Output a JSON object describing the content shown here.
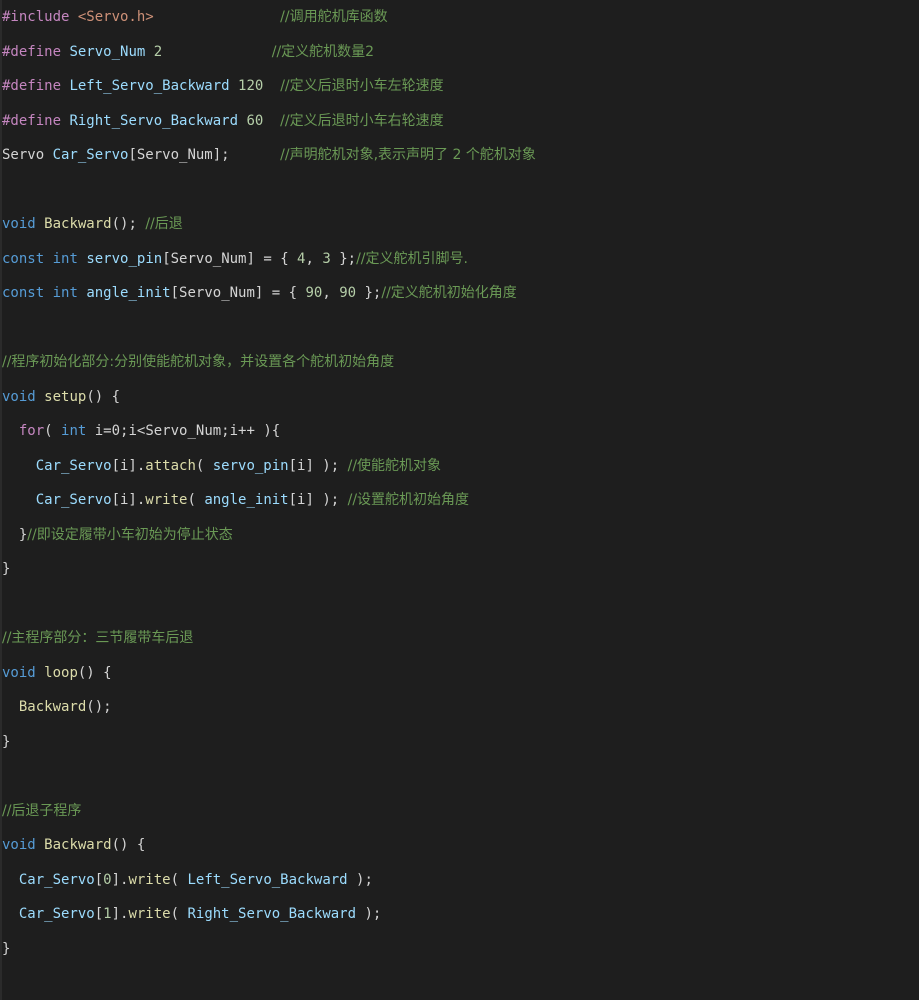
{
  "editor": {
    "colors": {
      "background": "#1e1e1e",
      "preprocessor": "#c586c0",
      "keyword": "#569cd6",
      "type": "#4ec9b0",
      "function": "#dcdcaa",
      "variable": "#9cdcfe",
      "number": "#b5cea8",
      "string": "#ce9178",
      "comment": "#6a9955",
      "plain": "#d4d4d4"
    },
    "lines": [
      {
        "tokens": [
          {
            "t": "pp",
            "v": "#include "
          },
          {
            "t": "str",
            "v": "<Servo.h>"
          },
          {
            "t": "p",
            "v": "               "
          },
          {
            "t": "cm",
            "v": "//调用舵机库函数"
          }
        ]
      },
      {
        "tokens": [
          {
            "t": "pp",
            "v": "#define "
          },
          {
            "t": "var",
            "v": "Servo_Num"
          },
          {
            "t": "p",
            "v": " "
          },
          {
            "t": "num",
            "v": "2"
          },
          {
            "t": "p",
            "v": "             "
          },
          {
            "t": "cm",
            "v": "//定义舵机数量2"
          }
        ]
      },
      {
        "tokens": [
          {
            "t": "pp",
            "v": "#define "
          },
          {
            "t": "var",
            "v": "Left_Servo_Backward"
          },
          {
            "t": "p",
            "v": " "
          },
          {
            "t": "num",
            "v": "120"
          },
          {
            "t": "p",
            "v": "  "
          },
          {
            "t": "cm",
            "v": "//定义后退时小车左轮速度"
          }
        ]
      },
      {
        "tokens": [
          {
            "t": "pp",
            "v": "#define "
          },
          {
            "t": "var",
            "v": "Right_Servo_Backward"
          },
          {
            "t": "p",
            "v": " "
          },
          {
            "t": "num",
            "v": "60"
          },
          {
            "t": "p",
            "v": "  "
          },
          {
            "t": "cm",
            "v": "//定义后退时小车右轮速度"
          }
        ]
      },
      {
        "tokens": [
          {
            "t": "p",
            "v": "Servo "
          },
          {
            "t": "var",
            "v": "Car_Servo"
          },
          {
            "t": "p",
            "v": "[Servo_Num];      "
          },
          {
            "t": "cm",
            "v": "//声明舵机对象,表示声明了 2 个舵机对象"
          }
        ]
      },
      {
        "tokens": []
      },
      {
        "tokens": [
          {
            "t": "kw",
            "v": "void"
          },
          {
            "t": "p",
            "v": " "
          },
          {
            "t": "fn",
            "v": "Backward"
          },
          {
            "t": "p",
            "v": "(); "
          },
          {
            "t": "cm",
            "v": "//后退"
          }
        ]
      },
      {
        "tokens": [
          {
            "t": "kw",
            "v": "const"
          },
          {
            "t": "p",
            "v": " "
          },
          {
            "t": "kw",
            "v": "int"
          },
          {
            "t": "p",
            "v": " "
          },
          {
            "t": "var",
            "v": "servo_pin"
          },
          {
            "t": "p",
            "v": "[Servo_Num] = { "
          },
          {
            "t": "num",
            "v": "4"
          },
          {
            "t": "p",
            "v": ", "
          },
          {
            "t": "num",
            "v": "3"
          },
          {
            "t": "p",
            "v": " };"
          },
          {
            "t": "cm",
            "v": "//定义舵机引脚号."
          }
        ]
      },
      {
        "tokens": [
          {
            "t": "kw",
            "v": "const"
          },
          {
            "t": "p",
            "v": " "
          },
          {
            "t": "kw",
            "v": "int"
          },
          {
            "t": "p",
            "v": " "
          },
          {
            "t": "var",
            "v": "angle_init"
          },
          {
            "t": "p",
            "v": "[Servo_Num] = { "
          },
          {
            "t": "num",
            "v": "90"
          },
          {
            "t": "p",
            "v": ", "
          },
          {
            "t": "num",
            "v": "90"
          },
          {
            "t": "p",
            "v": " };"
          },
          {
            "t": "cm",
            "v": "//定义舵机初始化角度"
          }
        ]
      },
      {
        "tokens": []
      },
      {
        "tokens": [
          {
            "t": "cm",
            "v": "//程序初始化部分:分别使能舵机对象，并设置各个舵机初始角度"
          }
        ]
      },
      {
        "tokens": [
          {
            "t": "kw",
            "v": "void"
          },
          {
            "t": "p",
            "v": " "
          },
          {
            "t": "fn",
            "v": "setup"
          },
          {
            "t": "p",
            "v": "() {"
          }
        ]
      },
      {
        "tokens": [
          {
            "t": "p",
            "v": "  "
          },
          {
            "t": "pp",
            "v": "for"
          },
          {
            "t": "p",
            "v": "( "
          },
          {
            "t": "kw",
            "v": "int"
          },
          {
            "t": "p",
            "v": " i=0;i<Servo_Num;i++ ){"
          }
        ]
      },
      {
        "tokens": [
          {
            "t": "p",
            "v": "    "
          },
          {
            "t": "var",
            "v": "Car_Servo"
          },
          {
            "t": "p",
            "v": "[i]."
          },
          {
            "t": "fn",
            "v": "attach"
          },
          {
            "t": "p",
            "v": "( "
          },
          {
            "t": "var",
            "v": "servo_pin"
          },
          {
            "t": "p",
            "v": "[i] ); "
          },
          {
            "t": "cm",
            "v": "//使能舵机对象"
          }
        ]
      },
      {
        "tokens": [
          {
            "t": "p",
            "v": "    "
          },
          {
            "t": "var",
            "v": "Car_Servo"
          },
          {
            "t": "p",
            "v": "[i]."
          },
          {
            "t": "fn",
            "v": "write"
          },
          {
            "t": "p",
            "v": "( "
          },
          {
            "t": "var",
            "v": "angle_init"
          },
          {
            "t": "p",
            "v": "[i] ); "
          },
          {
            "t": "cm",
            "v": "//设置舵机初始角度"
          }
        ]
      },
      {
        "tokens": [
          {
            "t": "p",
            "v": "  }"
          },
          {
            "t": "cm",
            "v": "//即设定履带小车初始为停止状态"
          }
        ]
      },
      {
        "tokens": [
          {
            "t": "p",
            "v": "}"
          }
        ]
      },
      {
        "tokens": []
      },
      {
        "tokens": [
          {
            "t": "cm",
            "v": "//主程序部分：三节履带车后退"
          }
        ]
      },
      {
        "tokens": [
          {
            "t": "kw",
            "v": "void"
          },
          {
            "t": "p",
            "v": " "
          },
          {
            "t": "fn",
            "v": "loop"
          },
          {
            "t": "p",
            "v": "() {"
          }
        ]
      },
      {
        "tokens": [
          {
            "t": "p",
            "v": "  "
          },
          {
            "t": "fn",
            "v": "Backward"
          },
          {
            "t": "p",
            "v": "();"
          }
        ]
      },
      {
        "tokens": [
          {
            "t": "p",
            "v": "}"
          }
        ]
      },
      {
        "tokens": []
      },
      {
        "tokens": [
          {
            "t": "cm",
            "v": "//后退子程序"
          }
        ]
      },
      {
        "tokens": [
          {
            "t": "kw",
            "v": "void"
          },
          {
            "t": "p",
            "v": " "
          },
          {
            "t": "fn",
            "v": "Backward"
          },
          {
            "t": "p",
            "v": "() {"
          }
        ]
      },
      {
        "tokens": [
          {
            "t": "p",
            "v": "  "
          },
          {
            "t": "var",
            "v": "Car_Servo"
          },
          {
            "t": "p",
            "v": "["
          },
          {
            "t": "num",
            "v": "0"
          },
          {
            "t": "p",
            "v": "]."
          },
          {
            "t": "fn",
            "v": "write"
          },
          {
            "t": "p",
            "v": "( "
          },
          {
            "t": "var",
            "v": "Left_Servo_Backward"
          },
          {
            "t": "p",
            "v": " );"
          }
        ]
      },
      {
        "tokens": [
          {
            "t": "p",
            "v": "  "
          },
          {
            "t": "var",
            "v": "Car_Servo"
          },
          {
            "t": "p",
            "v": "["
          },
          {
            "t": "num",
            "v": "1"
          },
          {
            "t": "p",
            "v": "]."
          },
          {
            "t": "fn",
            "v": "write"
          },
          {
            "t": "p",
            "v": "( "
          },
          {
            "t": "var",
            "v": "Right_Servo_Backward"
          },
          {
            "t": "p",
            "v": " );"
          }
        ]
      },
      {
        "tokens": [
          {
            "t": "p",
            "v": "}"
          }
        ]
      }
    ]
  }
}
